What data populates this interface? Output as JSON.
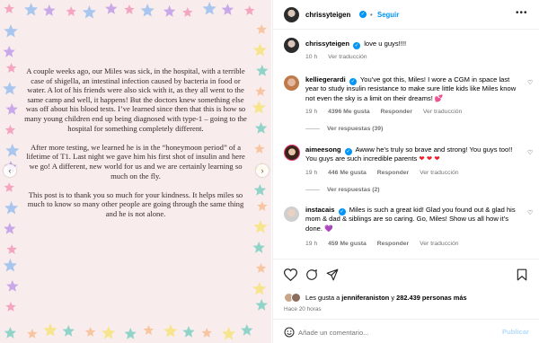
{
  "header": {
    "username": "chrissyteigen",
    "follow_label": "Seguir",
    "separator": "•",
    "more": "•••"
  },
  "post": {
    "paragraphs": [
      "A couple weeks ago, our Miles was sick, in the hospital, with a terrible case of shigella, an intestinal infection caused by bacteria in food or water. A lot of his friends were also sick with it, as they all went to the same camp and well, it happens! But the doctors knew something else was off about his blood tests. I’ve learned since then that this is how so many young children end up being diagnosed with type-1 – going to the hospital for something completely different.",
      "After more testing, we learned he is in the “honeymoon period” of a lifetime of T1. Last night we gave him his first shot of insulin and here we go! A different, new world for us and we are certainly learning so much on the fly.",
      "This post is to thank you so much for your kindness. It helps miles so much to know so many other people are going through the same thing and he is not alone."
    ],
    "prev_icon": "‹",
    "next_icon": "›"
  },
  "caption": {
    "username": "chrissyteigen",
    "text": "love u guys!!!!",
    "time": "10 h",
    "translate": "Ver traducción"
  },
  "comments": [
    {
      "username": "kelliegerardi",
      "text": "You’ve got this, Miles! I wore a CGM in space last year to study insulin resistance to make sure little kids like Miles know not even the sky is a limit on their dreams! 💕",
      "time": "19 h",
      "likes": "4396 Me gusta",
      "reply": "Responder",
      "translate": "Ver traducción",
      "replies": "Ver respuestas (39)"
    },
    {
      "username": "aimeesong",
      "text": "Awww he’s truly so brave and strong! You guys too!! You guys are such incredible parents",
      "hearts": "❤ ❤ ❤",
      "time": "19 h",
      "likes": "446 Me gusta",
      "reply": "Responder",
      "translate": "Ver traducción",
      "replies": "Ver respuestas (2)"
    },
    {
      "username": "instacais",
      "text": "Miles is such a great kid! Glad you found out & glad his mom & dad & siblings are so caring. Go, Miles! Show us all how it’s done. 💜",
      "time": "19 h",
      "likes": "459 Me gusta",
      "reply": "Responder",
      "translate": "Ver traducción"
    }
  ],
  "likes": {
    "prefix": "Les gusta a",
    "user": "jenniferaniston",
    "conjunction": "y",
    "others": "282.439 personas más"
  },
  "time_ago": "Hace 20 horas",
  "composer": {
    "placeholder": "Añade un comentario...",
    "publish": "Publicar"
  },
  "colors": {
    "accent": "#0095f6",
    "background_post": "#f8ecec",
    "star_palette": [
      "#f4a6c0",
      "#8fd3c9",
      "#a9c6ef",
      "#f7c59f",
      "#c8a8e9",
      "#f6e58d"
    ]
  }
}
